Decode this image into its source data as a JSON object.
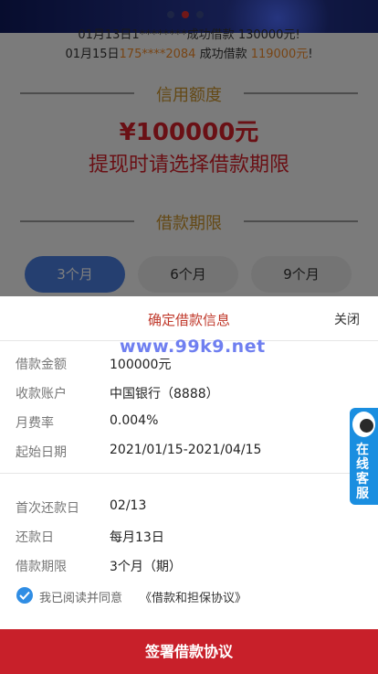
{
  "background": {
    "ticker": {
      "line1": "01月13日1********成功借款 130000元!",
      "line2_date": "01月15日",
      "line2_phone": "175****2084",
      "line2_mid": " 成功借款 ",
      "line2_amount": "119000元",
      "line2_end": "!"
    },
    "credit_title": "信用额度",
    "credit_amount": "¥100000元",
    "credit_hint": "提现时请选择借款期限",
    "period_title": "借款期限",
    "periods": [
      "3个月",
      "6个月",
      "9个月"
    ]
  },
  "sheet": {
    "title": "确定借款信息",
    "close_label": "关闭",
    "watermark": "www.99k9.net",
    "group1": [
      {
        "label": "借款金额",
        "value": "100000元"
      },
      {
        "label": "收款账户",
        "value": "中国银行（8888）"
      },
      {
        "label": "月费率",
        "value": "0.004%"
      },
      {
        "label": "起始日期",
        "value": "2021/01/15-2021/04/15"
      }
    ],
    "group2": [
      {
        "label": "首次还款日",
        "value": "02/13"
      },
      {
        "label": "还款日",
        "value": "每月13日"
      },
      {
        "label": "借款期限",
        "value": "3个月（期）"
      }
    ],
    "agree_text": "我已阅读并同意",
    "agree_link": "《借款和担保协议》",
    "sign_button": "签署借款协议"
  },
  "service": {
    "label": "在线客服"
  },
  "colors": {
    "accent": "#c8202a",
    "title_red": "#d4202a",
    "gold": "#c9932d",
    "blue": "#2f8de4"
  }
}
